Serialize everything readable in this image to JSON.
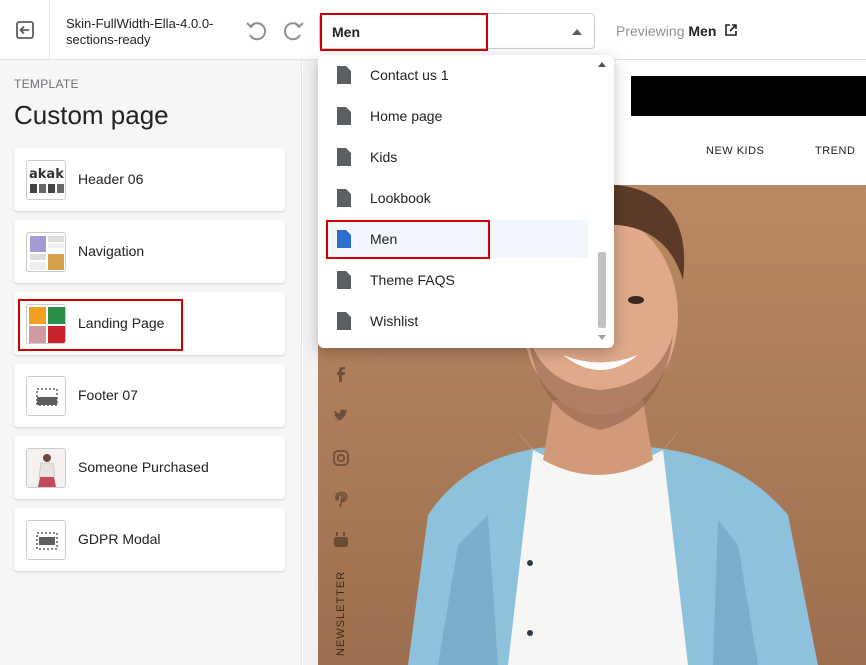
{
  "topbar": {
    "theme_name": "Skin-FullWidth-Ella-4.0.0-sections-ready",
    "page_select_value": "Men",
    "previewing_label": "Previewing",
    "previewing_page": "Men"
  },
  "sidebar": {
    "label": "TEMPLATE",
    "title": "Custom page",
    "sections": [
      {
        "label": "Header 06",
        "icon": "header-thumbnail"
      },
      {
        "label": "Navigation",
        "icon": "navigation-thumbnail"
      },
      {
        "label": "Landing Page",
        "icon": "landing-page-thumbnail"
      },
      {
        "label": "Footer 07",
        "icon": "footer-layout-icon"
      },
      {
        "label": "Someone Purchased",
        "icon": "product-photo-thumbnail"
      },
      {
        "label": "GDPR Modal",
        "icon": "modal-layout-icon"
      }
    ]
  },
  "dropdown": {
    "items": [
      {
        "label": "Contact us 1",
        "selected": false
      },
      {
        "label": "Home page",
        "selected": false
      },
      {
        "label": "Kids",
        "selected": false
      },
      {
        "label": "Lookbook",
        "selected": false
      },
      {
        "label": "Men",
        "selected": true
      },
      {
        "label": "Theme FAQS",
        "selected": false
      },
      {
        "label": "Wishlist",
        "selected": false
      }
    ]
  },
  "preview": {
    "nav": [
      "NEW KIDS",
      "TREND"
    ],
    "newsletter": "NEWSLETTER",
    "social_icons": [
      "facebook-icon",
      "twitter-icon",
      "instagram-icon",
      "pinterest-icon",
      "youtube-icon"
    ]
  },
  "colors": {
    "highlight": "#cc0000",
    "selected_item_bg": "#f2f7fe",
    "selected_page_icon": "#2c6ecb",
    "page_icon": "#5c5f62"
  }
}
